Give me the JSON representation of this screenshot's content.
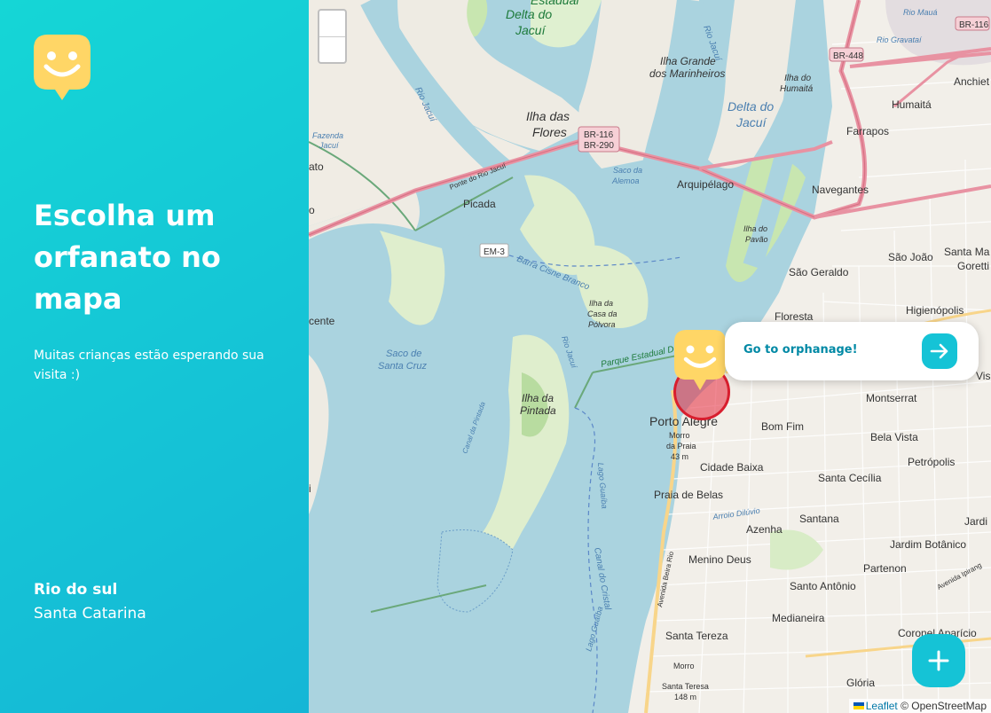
{
  "sidebar": {
    "logo_icon": "happy-face-pin-icon",
    "title": "Escolha um orfanato no mapa",
    "subtitle": "Muitas crianças estão esperando sua visita :)",
    "city": "Rio do sul",
    "state": "Santa Catarina"
  },
  "map": {
    "zoom_in_icon": "plus-icon",
    "zoom_out_icon": "minus-icon",
    "labels": {
      "estadual": "Estadual",
      "delta_do": "Delta do",
      "jacui": "Jacuí",
      "rio_jacui": "Rio Jacuí",
      "rio_jacui2": "Rio Jacuí",
      "delta_jacui2_a": "Delta do",
      "delta_jacui2_b": "Jacuí",
      "ilha_grande_a": "Ilha Grande",
      "ilha_grande_b": "dos Marinheiros",
      "ilha_humaita_a": "Ilha do",
      "ilha_humaita_b": "Humaitá",
      "ilha_flores_a": "Ilha das",
      "ilha_flores_b": "Flores",
      "br116_a": "BR-116",
      "br290": "BR-290",
      "br448": "BR-448",
      "br116_b": "BR-116",
      "rio_mau": "Rio Mauá",
      "rio_gravatai": "Rio Gravataí",
      "anchieta": "Anchiet",
      "humaita": "Humaitá",
      "farrapos": "Farrapos",
      "fazenda_a": "Fazenda",
      "fazenda_b": "Jacuí",
      "ato": "ato",
      "o": "o",
      "ponte": "Ponte do Rio Jacuí",
      "saco_alemoa_a": "Saco da",
      "saco_alemoa_b": "Alemoa",
      "arquipelago": "Arquipélago",
      "navegantes": "Navegantes",
      "picada": "Picada",
      "em3": "EM-3",
      "barra_cisne": "Barra Cisne Branco",
      "ilha_pavao_a": "Ilha do",
      "ilha_pavao_b": "Pavão",
      "sao_geraldo": "São Geraldo",
      "sao_joao": "São João",
      "santa_maria": "Santa Ma",
      "goretti": "Goretti",
      "floresta": "Floresta",
      "higienopolis": "Higienópolis",
      "cente": "cente",
      "ilha_casa_a": "Ilha da",
      "ilha_casa_b": "Casa da",
      "ilha_casa_c": "Pólvora",
      "rio_jacui3": "Rio Jacuí",
      "parque_estadual": "Parque Estadual D",
      "saco_cruz_a": "Saco de",
      "saco_cruz_b": "Santa Cruz",
      "ilha_pintada_a": "Ilha da",
      "ilha_pintada_b": "Pintada",
      "canal_pintada": "Canal da Pintada",
      "montserrat": "Montserrat",
      "porto_alegre": "Porto Alegre",
      "bom_fim": "Bom Fim",
      "bela_vista": "Bela Vista",
      "morro_a": "Morro",
      "morro_b": "da Praia",
      "morro_c": "43 m",
      "cidade_baixa": "Cidade Baixa",
      "santa_cecilia": "Santa Cecília",
      "petropolis": "Petrópolis",
      "lago_guaiba": "Lago Guaíba",
      "praia_belas": "Praia de Belas",
      "arroio_dilúvio": "Arroio Dilúvio",
      "santana": "Santana",
      "azenha": "Azenha",
      "jardim_botanico": "Jardim Botânico",
      "jardi": "Jardi",
      "av_beira_rio": "Avenida Beira Rio",
      "menino_deus": "Menino Deus",
      "partenon": "Partenon",
      "av_ipiranga": "Avenida Ipirang",
      "i": "i",
      "canal_cristal": "Canal do Cristal",
      "santo_antonio": "Santo Antônio",
      "medianeira": "Medianeira",
      "coronel": "Coronel Aparício",
      "santa_tereza": "Santa Tereza",
      "morro_st_a": "Morro",
      "morro_st_b": "Santa Teresa",
      "morro_st_c": "148 m",
      "lago_guaiba2": "Lago Guaíba",
      "gloria": "Glória",
      "vis": "Vis"
    },
    "popup": {
      "label": "Go to orphanage!",
      "button_icon": "arrow-right-icon"
    },
    "add_button_icon": "plus-icon",
    "attribution": {
      "leaflet": "Leaflet",
      "osm": "© OpenStreetMap"
    }
  },
  "colors": {
    "sidebar_gradient_start": "#15d6d6",
    "sidebar_gradient_end": "#15b6d6",
    "accent": "#15c3d6",
    "logo_yellow": "#ffd666",
    "popup_text": "#0089a5",
    "marker_ring": "#d81e2e"
  }
}
